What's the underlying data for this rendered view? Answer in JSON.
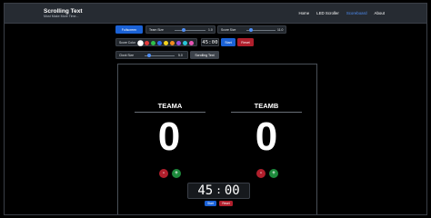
{
  "app": {
    "title": "Scrolling Text",
    "subtitle": "Must Make More Time..."
  },
  "nav": {
    "items": [
      {
        "label": "Home",
        "active": false
      },
      {
        "label": "LED Scroller",
        "active": false
      },
      {
        "label": "Scoreboard",
        "active": true
      },
      {
        "label": "About",
        "active": false
      }
    ]
  },
  "controls": {
    "fullscreen_label": "Fullscreen",
    "team_size": {
      "label": "Team Size",
      "value": "1.0",
      "level": 0.3
    },
    "score_size": {
      "label": "Score Size",
      "value": "11.0",
      "level": 0.15
    },
    "score_color": {
      "label": "Score Color",
      "colors": [
        "#ffffff",
        "#e23a3a",
        "#2fbf4a",
        "#2e6cf0",
        "#f2d21e",
        "#f28c1e",
        "#9b4de0",
        "#29c6d8",
        "#e855b6"
      ],
      "selected_index": 0
    },
    "clock_time": "45:00",
    "start_label": "Start",
    "reset_label": "Reset",
    "clock_size": {
      "label": "Clock Size",
      "value": "5.0",
      "level": 0.15
    },
    "scrolling_text_label": "Scrolling Text"
  },
  "scoreboard": {
    "team_a": {
      "name": "TEAMA",
      "score": "0"
    },
    "team_b": {
      "name": "TEAMB",
      "score": "0"
    },
    "minus_label": "-",
    "plus_label": "+",
    "clock_minutes": "45",
    "clock_colon": ":",
    "clock_seconds": "00",
    "start_label": "Start",
    "reset_label": "Reset"
  }
}
